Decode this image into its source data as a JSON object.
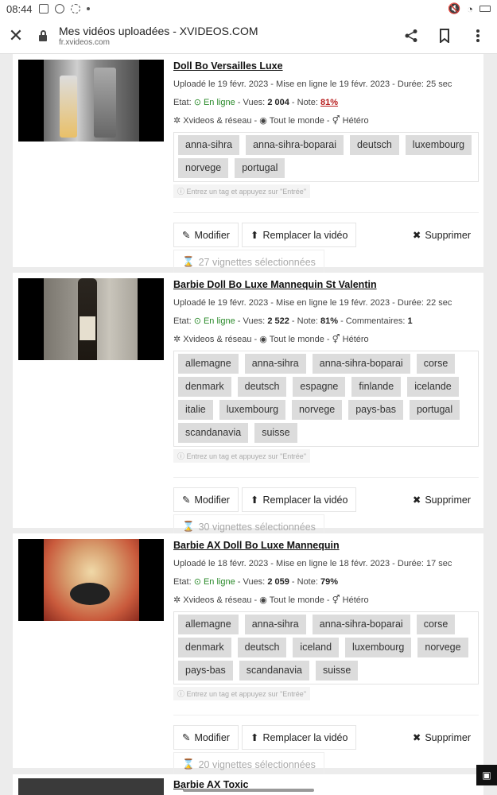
{
  "status": {
    "time": "08:44"
  },
  "browser": {
    "title": "Mes vidéos uploadées - XVIDEOS.COM",
    "url": "fr.xvideos.com"
  },
  "labels": {
    "modifier": "Modifier",
    "remplacer": "Remplacer la vidéo",
    "supprimer": "Supprimer",
    "hint": "Entrez un tag et appuyez sur \"Entrée\""
  },
  "videos": [
    {
      "title": "Doll Bo Versailles Luxe",
      "upload_line": "Uploadé le 19 févr. 2023 - Mise en ligne le 19 févr. 2023 - Durée: 25 sec",
      "etat_prefix": "Etat:",
      "etat": "En ligne",
      "vues_prefix": "- Vues:",
      "vues": "2 004",
      "note_prefix": "- Note:",
      "note": "81%",
      "distrib": "Xvideos & réseau",
      "audience": "Tout le monde",
      "orientation": "Hétéro",
      "tags": [
        "anna-sihra",
        "anna-sihra-boparai",
        "deutsch",
        "luxembourg",
        "norvege",
        "portugal"
      ],
      "vignettes": "27 vignettes sélectionnées"
    },
    {
      "title": "Barbie Doll Bo Luxe Mannequin St Valentin",
      "upload_line": "Uploadé le 19 févr. 2023 - Mise en ligne le 19 févr. 2023 - Durée: 22 sec",
      "etat_prefix": "Etat:",
      "etat": "En ligne",
      "vues_prefix": "- Vues:",
      "vues": "2 522",
      "note_prefix": "- Note:",
      "note": "81%",
      "comments_prefix": "- Commentaires:",
      "comments": "1",
      "distrib": "Xvideos & réseau",
      "audience": "Tout le monde",
      "orientation": "Hétéro",
      "tags": [
        "allemagne",
        "anna-sihra",
        "anna-sihra-boparai",
        "corse",
        "denmark",
        "deutsch",
        "espagne",
        "finlande",
        "icelande",
        "italie",
        "luxembourg",
        "norvege",
        "pays-bas",
        "portugal",
        "scandanavia",
        "suisse"
      ],
      "vignettes": "30 vignettes sélectionnées"
    },
    {
      "title": "Barbie AX Doll Bo Luxe Mannequin",
      "upload_line": "Uploadé le 18 févr. 2023 - Mise en ligne le 18 févr. 2023 - Durée: 17 sec",
      "etat_prefix": "Etat:",
      "etat": "En ligne",
      "vues_prefix": "- Vues:",
      "vues": "2 059",
      "note_prefix": "- Note:",
      "note": "79%",
      "distrib": "Xvideos & réseau",
      "audience": "Tout le monde",
      "orientation": "Hétéro",
      "tags": [
        "allemagne",
        "anna-sihra",
        "anna-sihra-boparai",
        "corse",
        "denmark",
        "deutsch",
        "iceland",
        "luxembourg",
        "norvege",
        "pays-bas",
        "scandanavia",
        "suisse"
      ],
      "vignettes": "20 vignettes sélectionnées"
    },
    {
      "title": "Barbie AX Toxic"
    }
  ]
}
